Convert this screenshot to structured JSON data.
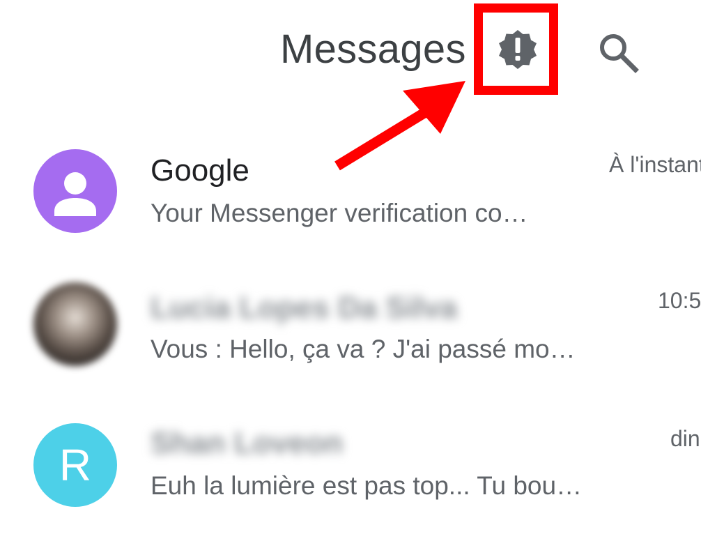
{
  "header": {
    "title": "Messages",
    "alert_icon": "alert-badge-icon",
    "search_icon": "search-icon",
    "alert_badge_symbol": "!"
  },
  "annotation": {
    "highlight_color": "#ff0000"
  },
  "conversations": [
    {
      "name": "Google",
      "snippet": "Your Messenger verification co…",
      "time": "À l'instant",
      "avatar": {
        "type": "person-icon",
        "color": "#a56cf0"
      }
    },
    {
      "name": "Lucia Lopes Da Silva",
      "snippet": "Vous : Hello, ça va ? J'ai passé mo…",
      "time": "10:5",
      "avatar": {
        "type": "photo"
      }
    },
    {
      "name": "Shan Loveon",
      "snippet": "Euh la lumière est pas top... Tu bou…",
      "time": "din",
      "avatar": {
        "type": "letter",
        "letter": "R",
        "color": "#4dd0e8"
      }
    }
  ]
}
